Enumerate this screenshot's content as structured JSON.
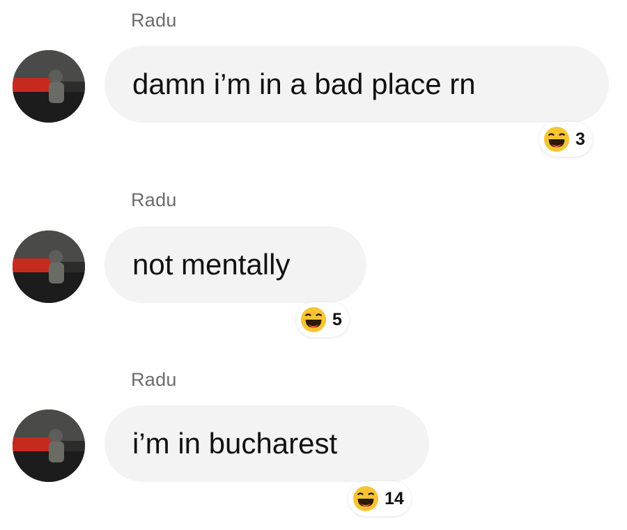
{
  "messages": [
    {
      "sender": "Radu",
      "text": "damn i’m in a bad place rn",
      "reaction": {
        "icon": "laughing-emoji-icon",
        "count": "3"
      }
    },
    {
      "sender": "Radu",
      "text": "not mentally",
      "reaction": {
        "icon": "laughing-emoji-icon",
        "count": "5"
      }
    },
    {
      "sender": "Radu",
      "text": "i’m in bucharest",
      "reaction": {
        "icon": "laughing-emoji-icon",
        "count": "14"
      }
    }
  ],
  "colors": {
    "bubble": "#f4f3f3",
    "sender": "#6b6b6b",
    "emoji": "#f7c531"
  }
}
